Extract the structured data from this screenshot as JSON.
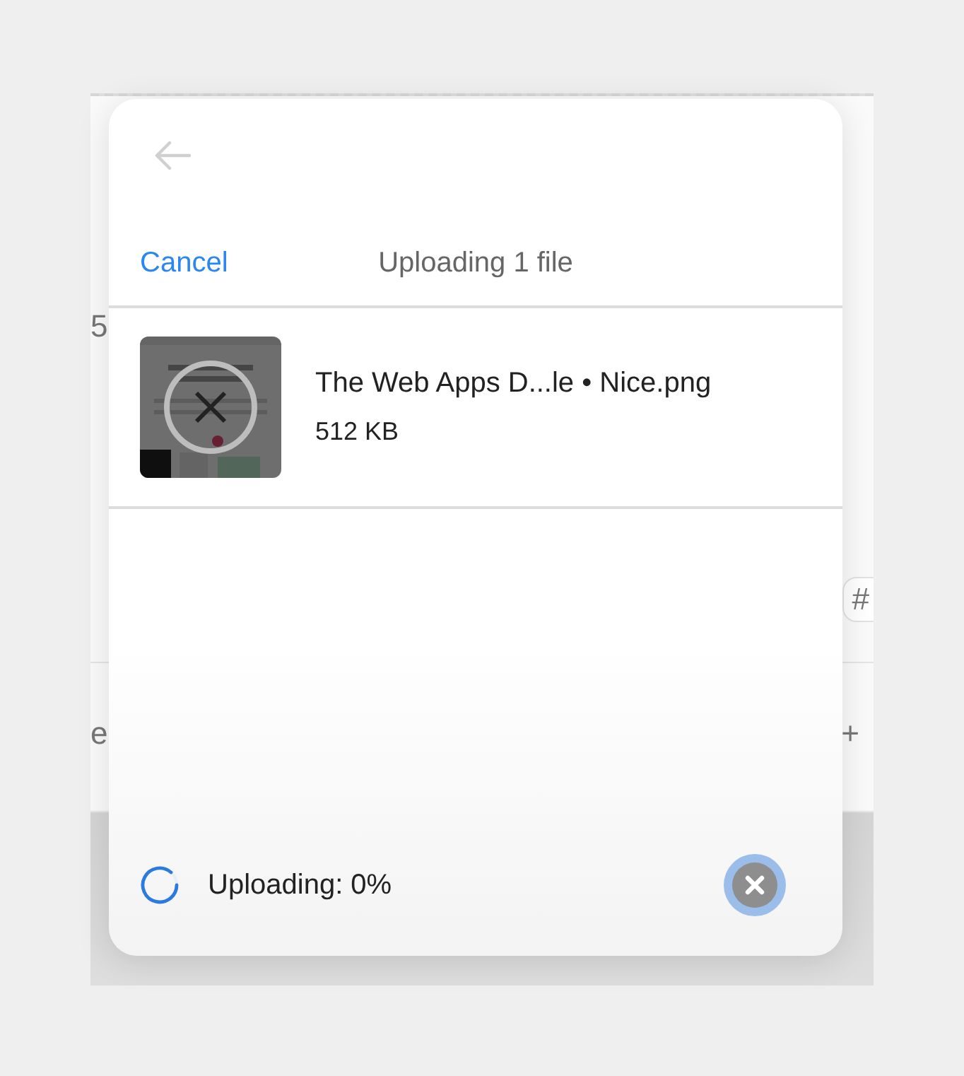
{
  "background": {
    "fragments": [
      {
        "text": "5",
        "kind": "upper"
      },
      {
        "text": "#",
        "kind": "chip"
      },
      {
        "text": "e",
        "kind": "lower"
      },
      {
        "text": "+",
        "kind": "plus"
      }
    ]
  },
  "header": {
    "cancel": "Cancel",
    "title": "Uploading 1 file"
  },
  "files": [
    {
      "name": "The Web Apps D...le • Nice.png",
      "size": "512 KB"
    }
  ],
  "footer": {
    "status": "Uploading: 0%"
  }
}
